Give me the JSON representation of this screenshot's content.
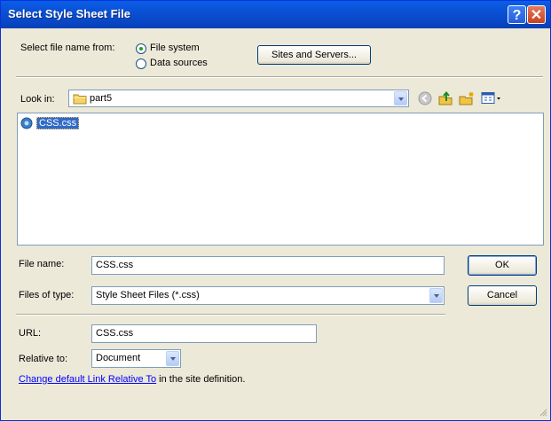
{
  "window": {
    "title": "Select Style Sheet File"
  },
  "titlebar": {
    "help_label": "?",
    "close_label": "✕"
  },
  "source": {
    "label": "Select file name from:",
    "options": [
      "File system",
      "Data sources"
    ],
    "selected": "File system"
  },
  "sites_button": "Sites and Servers...",
  "lookin": {
    "label": "Look in:",
    "value": "part5"
  },
  "files": [
    {
      "name": "CSS.css"
    }
  ],
  "filename": {
    "label": "File name:",
    "value": "CSS.css"
  },
  "filetype": {
    "label": "Files of type:",
    "value": "Style Sheet Files (*.css)"
  },
  "ok_label": "OK",
  "cancel_label": "Cancel",
  "url": {
    "label": "URL:",
    "value": "CSS.css"
  },
  "relative": {
    "label": "Relative to:",
    "value": "Document"
  },
  "footer": {
    "link": "Change default Link Relative To",
    "suffix": " in the site definition."
  },
  "colors": {
    "title_blue": "#0a53d8",
    "dialog_bg": "#ece9d8",
    "selection": "#316ac5",
    "link": "#0000ff"
  },
  "icons": [
    "back-icon",
    "up-folder-icon",
    "new-folder-icon",
    "view-menu-icon",
    "folder-icon",
    "css-file-icon"
  ]
}
